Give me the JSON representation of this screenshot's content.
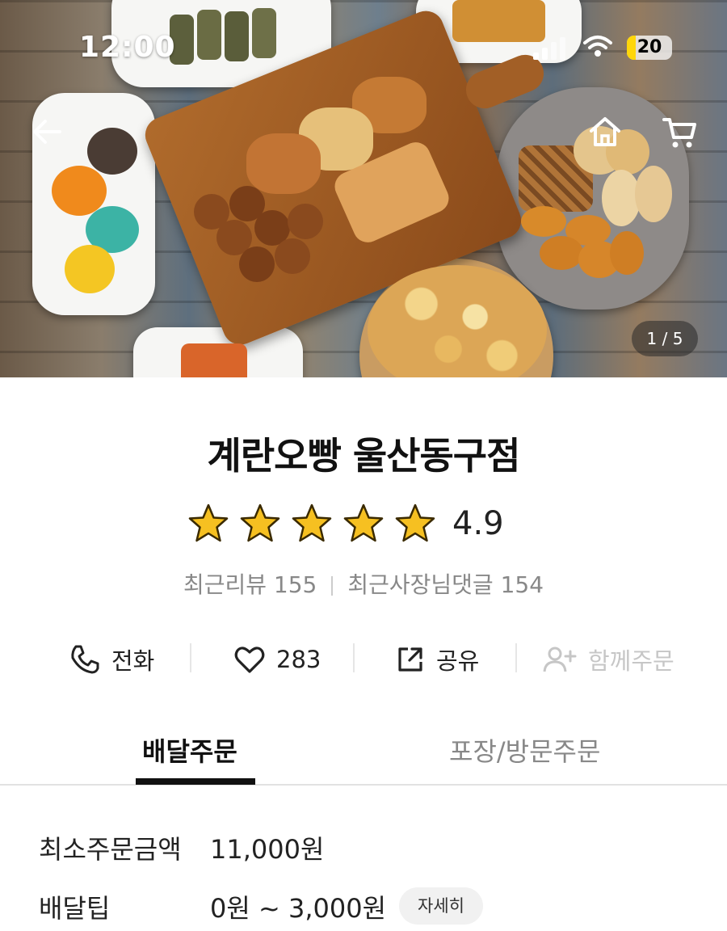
{
  "status_bar": {
    "time": "12:00",
    "battery": "20",
    "battery_level": 0.2
  },
  "hero": {
    "image_pager": "1 / 5"
  },
  "store": {
    "name": "계란오빵 울산동구점",
    "rating": "4.9",
    "stars": 5,
    "recent_reviews_label": "최근리뷰 155",
    "recent_owner_replies_label": "최근사장님댓글 154"
  },
  "actions": {
    "call_label": "전화",
    "like_count": "283",
    "share_label": "공유",
    "group_order_label": "함께주문"
  },
  "tabs": {
    "delivery": "배달주문",
    "pickup": "포장/방문주문"
  },
  "order_info": {
    "min_order_label": "최소주문금액",
    "min_order_value": "11,000원",
    "delivery_tip_label": "배달팁",
    "delivery_tip_value": "0원 ~ 3,000원",
    "detail_button": "자세히"
  },
  "colors": {
    "star": "#f6c021",
    "accent": "#111111",
    "battery": "#ffd60a"
  },
  "icons": [
    "back-arrow-icon",
    "home-icon",
    "cart-icon",
    "phone-icon",
    "heart-icon",
    "share-icon",
    "add-user-icon",
    "star-icon"
  ]
}
